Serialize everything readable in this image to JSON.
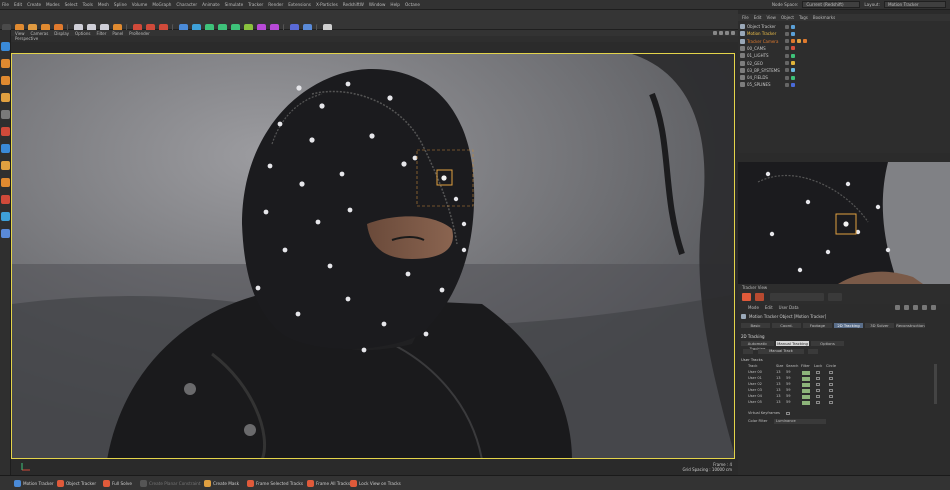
{
  "menubar": {
    "items": [
      "File",
      "Edit",
      "Create",
      "Modes",
      "Select",
      "Tools",
      "Mesh",
      "Spline",
      "Volume",
      "MoGraph",
      "Character",
      "Animate",
      "Simulate",
      "Tracker",
      "Render",
      "Extensions",
      "X-Particles",
      "RedshiftW",
      "Window",
      "Help",
      "Octane"
    ],
    "node_space_label": "Node Space:",
    "node_space_value": "Current (Redshift)",
    "layout_label": "Layout:",
    "layout_value": "Motion Tracker"
  },
  "viewport": {
    "menu": [
      "View",
      "Cameras",
      "Display",
      "Options",
      "Filter",
      "Panel",
      "ProRender"
    ],
    "label": "Perspective",
    "info_line1": "Frame : 4",
    "info_line2": "Grid Spacing : 10000 cm"
  },
  "object_manager": {
    "menu": [
      "File",
      "Edit",
      "View",
      "Object",
      "Tags",
      "Bookmarks"
    ],
    "objects": [
      {
        "name": "Object Tracker",
        "color": "#9aa8b8",
        "text": "#c8c8c8"
      },
      {
        "name": "Motion Tracker",
        "color": "#9aa8b8",
        "text": "#f0c14a"
      },
      {
        "name": "Tracker Camera",
        "color": "#9aa8b8",
        "text": "#e07a2e"
      },
      {
        "name": "00_CAMS",
        "color": "#7d7d7d",
        "text": "#c8c8c8"
      },
      {
        "name": "01_LIGHTS",
        "color": "#7d7d7d",
        "text": "#c8c8c8"
      },
      {
        "name": "02_GEO",
        "color": "#7d7d7d",
        "text": "#c8c8c8"
      },
      {
        "name": "03_BP_SYSTEMS",
        "color": "#7d7d7d",
        "text": "#c8c8c8"
      },
      {
        "name": "04_FIELDS",
        "color": "#7d7d7d",
        "text": "#c8c8c8"
      },
      {
        "name": "05_SPLINES",
        "color": "#7d7d7d",
        "text": "#c8c8c8"
      }
    ],
    "tag_colors": [
      "#5aa0d8",
      "#5aa0d8",
      "#e07a2e",
      "#d8503a",
      "#3ec27a",
      "#e0b43a",
      "#6bb8e0",
      "#3ec27a",
      "#4a6ad8"
    ]
  },
  "tracker_view": {
    "label": "Tracker View"
  },
  "attributes": {
    "menu": [
      "Mode",
      "Edit",
      "User Data"
    ],
    "object_title": "Motion Tracker Object [Motion Tracker]",
    "tabs": [
      "Basic",
      "Coord.",
      "Footage",
      "2D Tracking",
      "3D Solver",
      "Reconstruction"
    ],
    "section_title": "2D Tracking",
    "subtabs": [
      "Automatic Tracking",
      "Manual Tracking",
      "Options"
    ],
    "manual_track_dropdown": "Manual Track",
    "user_tracks_label": "User Tracks",
    "columns": [
      "Track",
      "Size",
      "Search",
      "Filter",
      "Lock",
      "Circle"
    ],
    "rows": [
      {
        "track": "User 00",
        "size": "13",
        "search": "59"
      },
      {
        "track": "User 01",
        "size": "13",
        "search": "59"
      },
      {
        "track": "User 02",
        "size": "13",
        "search": "59"
      },
      {
        "track": "User 03",
        "size": "13",
        "search": "59"
      },
      {
        "track": "User 04",
        "size": "13",
        "search": "59"
      },
      {
        "track": "User 05",
        "size": "13",
        "search": "59"
      }
    ],
    "virtual_keyframes_label": "Virtual Keyframes",
    "color_filter_label": "Color Filter",
    "color_filter_value": "Luminance"
  },
  "bottombar": {
    "buttons": [
      {
        "label": "Motion Tracker",
        "color": "#4a8ad8"
      },
      {
        "label": "Object Tracker",
        "color": "#e05a3a"
      },
      {
        "label": "Full Solve",
        "color": "#e05a3a"
      },
      {
        "label": "Create Planar Constraint",
        "color": "#555"
      },
      {
        "label": "Create Mask",
        "color": "#e0a040"
      },
      {
        "label": "Frame Selected Tracks",
        "color": "#e05a3a"
      },
      {
        "label": "Frame All Tracks",
        "color": "#e05a3a"
      },
      {
        "label": "Lock View on Tracks",
        "color": "#e05a3a"
      }
    ]
  }
}
